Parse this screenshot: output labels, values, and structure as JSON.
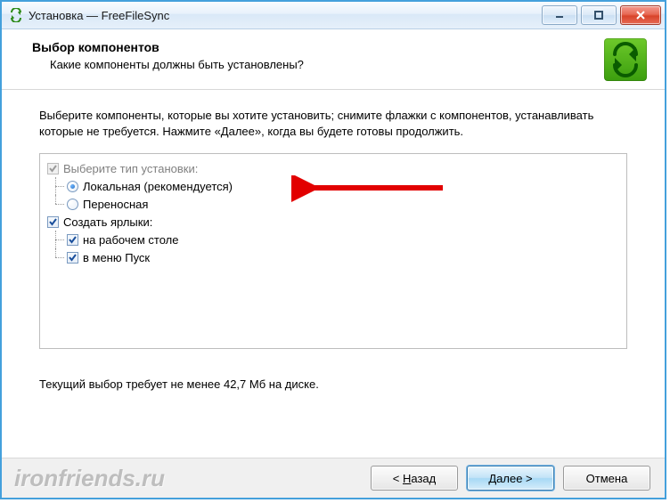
{
  "window": {
    "title": "Установка — FreeFileSync"
  },
  "header": {
    "title": "Выбор компонентов",
    "subtitle": "Какие компоненты должны быть установлены?"
  },
  "body": {
    "instruction": "Выберите компоненты, которые вы хотите установить; снимите флажки с компонентов, устанавливать которые не требуется. Нажмите «Далее», когда вы будете готовы продолжить.",
    "tree": {
      "install_type": {
        "label": "Выберите тип установки:",
        "checked": true,
        "disabled": true,
        "options": {
          "local": {
            "label": "Локальная (рекомендуется)",
            "selected": true
          },
          "portable": {
            "label": "Переносная",
            "selected": false
          }
        }
      },
      "shortcuts": {
        "label": "Создать ярлыки:",
        "checked": true,
        "children": {
          "desktop": {
            "label": "на рабочем столе",
            "checked": true
          },
          "startmenu": {
            "label": "в меню Пуск",
            "checked": true
          }
        }
      }
    },
    "disk_req": "Текущий выбор требует не менее 42,7 Мб на диске."
  },
  "footer": {
    "back": "< Назад",
    "next": "Далее >",
    "cancel": "Отмена"
  },
  "watermark": "ironfriends.ru",
  "icons": {
    "app": "sync-icon",
    "logo": "sync-arrows-icon"
  }
}
